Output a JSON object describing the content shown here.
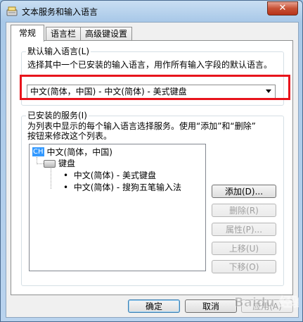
{
  "window": {
    "title": "文本服务和输入语言",
    "close_label": "✕"
  },
  "tabs": [
    {
      "label": "常规",
      "active": true
    },
    {
      "label": "语言栏",
      "active": false
    },
    {
      "label": "高级键设置",
      "active": false
    }
  ],
  "default_language": {
    "legend": "默认输入语言(L)",
    "description": "选择其中一个已安装的输入语言，用作所有输入字段的默认语言。",
    "selected": "中文(简体，中国) - 中文(简体) - 美式键盘"
  },
  "installed_services": {
    "legend": "已安装的服务(I)",
    "description_line1": "为列表中显示的每个输入语言选择服务。使用“添加”和“删除”",
    "description_line2": "按钮来修改这个列表。",
    "tree": {
      "language_badge": "CH",
      "language": "中文(简体，中国)",
      "category": "键盘",
      "items": [
        "中文(简体) - 美式键盘",
        "中文(简体) - 搜狗五笔输入法"
      ]
    },
    "buttons": {
      "add": "添加(D)...",
      "remove": "删除(R)",
      "properties": "属性(P)...",
      "move_up": "上移(U)",
      "move_down": "下移(O)"
    }
  },
  "footer": {
    "ok": "确定",
    "cancel": "取消",
    "apply": "应用(A)"
  },
  "watermark": "Baidu 经验"
}
